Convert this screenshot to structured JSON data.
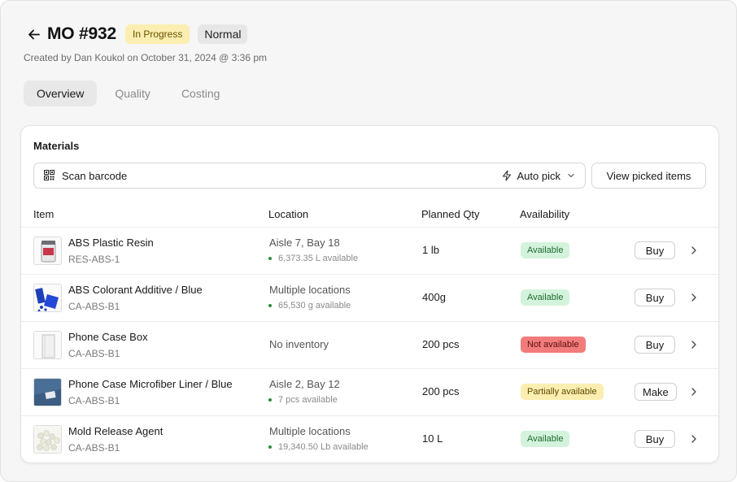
{
  "header": {
    "title": "MO #932",
    "status": "In Progress",
    "priority": "Normal",
    "created": "Created by Dan Koukol on October 31, 2024 @ 3:36 pm"
  },
  "tabs": [
    "Overview",
    "Quality",
    "Costing"
  ],
  "materials": {
    "title": "Materials",
    "scan_label": "Scan barcode",
    "auto_pick": "Auto pick",
    "view_picked": "View picked items",
    "columns": {
      "item": "Item",
      "location": "Location",
      "planned_qty": "Planned Qty",
      "availability": "Availability"
    },
    "rows": [
      {
        "name": "ABS Plastic Resin",
        "sku": "RES-ABS-1",
        "location": "Aisle 7, Bay 18",
        "available": "6,373.35 L available",
        "qty": "1 lb",
        "status": "Available",
        "action": "Buy"
      },
      {
        "name": "ABS Colorant Additive / Blue",
        "sku": "CA-ABS-B1",
        "location": "Multiple locations",
        "available": "65,530 g available",
        "qty": "400g",
        "status": "Available",
        "action": "Buy"
      },
      {
        "name": "Phone Case Box",
        "sku": "CA-ABS-B1",
        "location": "No inventory",
        "available": "",
        "qty": "200 pcs",
        "status": "Not available",
        "action": "Buy"
      },
      {
        "name": "Phone Case Microfiber Liner / Blue",
        "sku": "CA-ABS-B1",
        "location": "Aisle 2, Bay 12",
        "available": "7 pcs available",
        "qty": "200 pcs",
        "status": "Partially available",
        "action": "Make"
      },
      {
        "name": "Mold Release Agent",
        "sku": "CA-ABS-B1",
        "location": "Multiple locations",
        "available": "19,340.50 Lb available",
        "qty": "10 L",
        "status": "Available",
        "action": "Buy"
      }
    ]
  },
  "colors": {
    "status_in_progress": "#fbeeb0",
    "available": "#d4f3dc",
    "not_available": "#f27c7c",
    "partially_available": "#fbeeb0"
  },
  "icons": [
    "back-arrow-icon",
    "qr-code-icon",
    "bolt-icon",
    "chevron-down-icon",
    "chevron-right-icon"
  ]
}
